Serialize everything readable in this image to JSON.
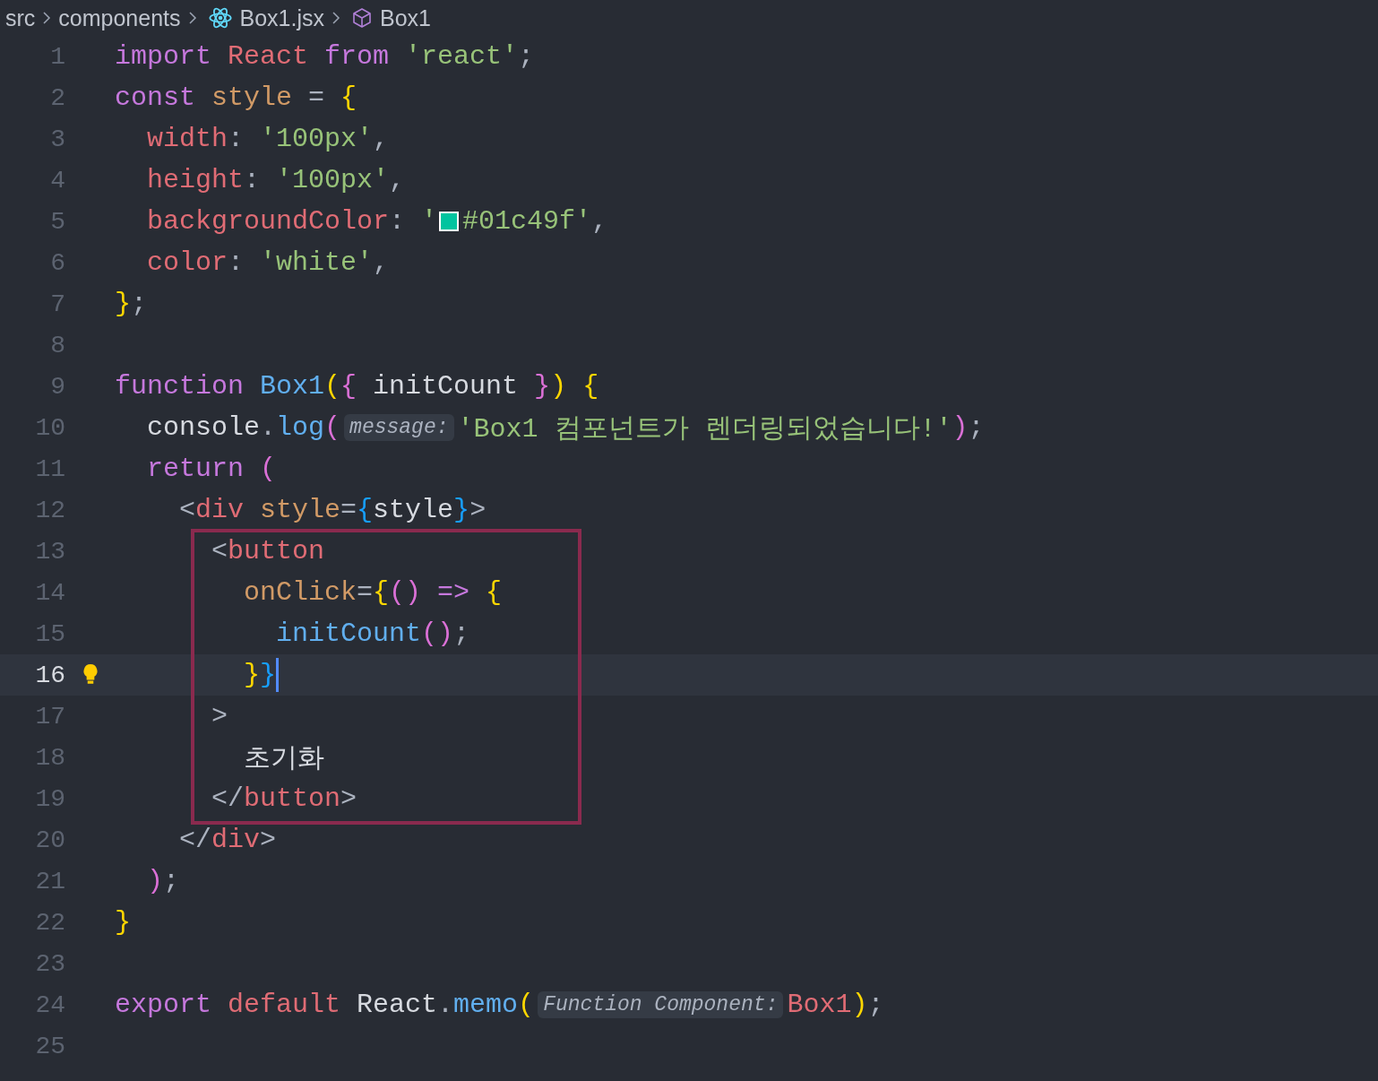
{
  "breadcrumb": [
    {
      "text": "src",
      "kind": "folder"
    },
    {
      "text": "components",
      "kind": "folder"
    },
    {
      "text": "Box1.jsx",
      "kind": "react-file"
    },
    {
      "text": "Box1",
      "kind": "symbol"
    }
  ],
  "lines": [
    {
      "number": "1",
      "active": false,
      "tokens": [
        {
          "text": "import ",
          "kind": "kw"
        },
        {
          "text": "React ",
          "kind": "var"
        },
        {
          "text": "from ",
          "kind": "kw"
        },
        {
          "text": "'react'",
          "kind": "str"
        },
        {
          "text": ";",
          "kind": "punc"
        }
      ]
    },
    {
      "number": "2",
      "active": false,
      "tokens": [
        {
          "text": "const ",
          "kind": "kw"
        },
        {
          "text": "style",
          "kind": "attr"
        },
        {
          "text": " = ",
          "kind": "punc"
        },
        {
          "text": "{",
          "kind": "b1"
        }
      ]
    },
    {
      "number": "3",
      "active": false,
      "tokens": [
        {
          "text": "  width",
          "kind": "prop"
        },
        {
          "text": ": ",
          "kind": "punc"
        },
        {
          "text": "'100px'",
          "kind": "str"
        },
        {
          "text": ",",
          "kind": "punc"
        }
      ]
    },
    {
      "number": "4",
      "active": false,
      "tokens": [
        {
          "text": "  height",
          "kind": "prop"
        },
        {
          "text": ": ",
          "kind": "punc"
        },
        {
          "text": "'100px'",
          "kind": "str"
        },
        {
          "text": ",",
          "kind": "punc"
        }
      ]
    },
    {
      "number": "5",
      "active": false,
      "tokens": [
        {
          "text": "  backgroundColor",
          "kind": "prop"
        },
        {
          "text": ": ",
          "kind": "punc"
        },
        {
          "text": "'",
          "kind": "str"
        },
        {
          "kind": "swatch",
          "color": "#01c49f"
        },
        {
          "text": "#01c49f'",
          "kind": "str"
        },
        {
          "text": ",",
          "kind": "punc"
        }
      ]
    },
    {
      "number": "6",
      "active": false,
      "tokens": [
        {
          "text": "  color",
          "kind": "prop"
        },
        {
          "text": ": ",
          "kind": "punc"
        },
        {
          "text": "'white'",
          "kind": "str"
        },
        {
          "text": ",",
          "kind": "punc"
        }
      ]
    },
    {
      "number": "7",
      "active": false,
      "tokens": [
        {
          "text": "}",
          "kind": "b1"
        },
        {
          "text": ";",
          "kind": "punc"
        }
      ]
    },
    {
      "number": "8",
      "active": false
    },
    {
      "number": "9",
      "active": false,
      "tokens": [
        {
          "text": "function ",
          "kind": "kw"
        },
        {
          "text": "Box1",
          "kind": "fn"
        },
        {
          "text": "(",
          "kind": "b1"
        },
        {
          "text": "{ ",
          "kind": "b2"
        },
        {
          "text": "initCount",
          "kind": "plain"
        },
        {
          "text": " }",
          "kind": "b2"
        },
        {
          "text": ")",
          "kind": "b1"
        },
        {
          "text": " {",
          "kind": "b1"
        }
      ]
    },
    {
      "number": "10",
      "active": false,
      "tokens": [
        {
          "text": "  console",
          "kind": "plain"
        },
        {
          "text": ".",
          "kind": "punc"
        },
        {
          "text": "log",
          "kind": "fn"
        },
        {
          "text": "(",
          "kind": "b2"
        },
        {
          "text": "message:",
          "kind": "hint"
        },
        {
          "text": "'Box1 컴포넌트가 렌더링되었습니다!'",
          "kind": "str"
        },
        {
          "text": ")",
          "kind": "b2"
        },
        {
          "text": ";",
          "kind": "punc"
        }
      ]
    },
    {
      "number": "11",
      "active": false,
      "tokens": [
        {
          "text": "  return ",
          "kind": "kw"
        },
        {
          "text": "(",
          "kind": "b2"
        }
      ]
    },
    {
      "number": "12",
      "active": false,
      "tokens": [
        {
          "text": "    <",
          "kind": "punc"
        },
        {
          "text": "div",
          "kind": "tag"
        },
        {
          "text": " style",
          "kind": "attr"
        },
        {
          "text": "=",
          "kind": "punc"
        },
        {
          "text": "{",
          "kind": "b3"
        },
        {
          "text": "style",
          "kind": "plain"
        },
        {
          "text": "}",
          "kind": "b3"
        },
        {
          "text": ">",
          "kind": "punc"
        }
      ]
    },
    {
      "number": "13",
      "active": false,
      "tokens": [
        {
          "text": "      <",
          "kind": "punc"
        },
        {
          "text": "button",
          "kind": "tag"
        }
      ]
    },
    {
      "number": "14",
      "active": false,
      "tokens": [
        {
          "text": "        onClick",
          "kind": "attr"
        },
        {
          "text": "=",
          "kind": "punc"
        },
        {
          "text": "{",
          "kind": "b1"
        },
        {
          "text": "()",
          "kind": "b2"
        },
        {
          "text": " => ",
          "kind": "kw"
        },
        {
          "text": "{",
          "kind": "b1"
        }
      ]
    },
    {
      "number": "15",
      "active": false,
      "tokens": [
        {
          "text": "          initCount",
          "kind": "fn"
        },
        {
          "text": "()",
          "kind": "b2"
        },
        {
          "text": ";",
          "kind": "punc"
        }
      ]
    },
    {
      "number": "16",
      "active": true,
      "tokens": [
        {
          "text": "        }",
          "kind": "b1"
        },
        {
          "text": "}",
          "kind": "b3"
        }
      ]
    },
    {
      "number": "17",
      "active": false,
      "tokens": [
        {
          "text": "      >",
          "kind": "punc"
        }
      ]
    },
    {
      "number": "18",
      "active": false,
      "tokens": [
        {
          "text": "        초기화",
          "kind": "plain"
        }
      ]
    },
    {
      "number": "19",
      "active": false,
      "tokens": [
        {
          "text": "      </",
          "kind": "punc"
        },
        {
          "text": "button",
          "kind": "tag"
        },
        {
          "text": ">",
          "kind": "punc"
        }
      ]
    },
    {
      "number": "20",
      "active": false,
      "tokens": [
        {
          "text": "    </",
          "kind": "punc"
        },
        {
          "text": "div",
          "kind": "tag"
        },
        {
          "text": ">",
          "kind": "punc"
        }
      ]
    },
    {
      "number": "21",
      "active": false,
      "tokens": [
        {
          "text": "  )",
          "kind": "b2"
        },
        {
          "text": ";",
          "kind": "punc"
        }
      ]
    },
    {
      "number": "22",
      "active": false,
      "tokens": [
        {
          "text": "}",
          "kind": "b1"
        }
      ]
    },
    {
      "number": "23",
      "active": false
    },
    {
      "number": "24",
      "active": false,
      "tokens": [
        {
          "text": "export ",
          "kind": "kw"
        },
        {
          "text": "default ",
          "kind": "var"
        },
        {
          "text": "React",
          "kind": "plain"
        },
        {
          "text": ".",
          "kind": "punc"
        },
        {
          "text": "memo",
          "kind": "fn"
        },
        {
          "text": "(",
          "kind": "b1"
        },
        {
          "text": "Function Component:",
          "kind": "hint"
        },
        {
          "text": "Box1",
          "kind": "var"
        },
        {
          "text": ")",
          "kind": "b1"
        },
        {
          "text": ";",
          "kind": "punc"
        }
      ]
    },
    {
      "number": "25",
      "active": false
    }
  ]
}
